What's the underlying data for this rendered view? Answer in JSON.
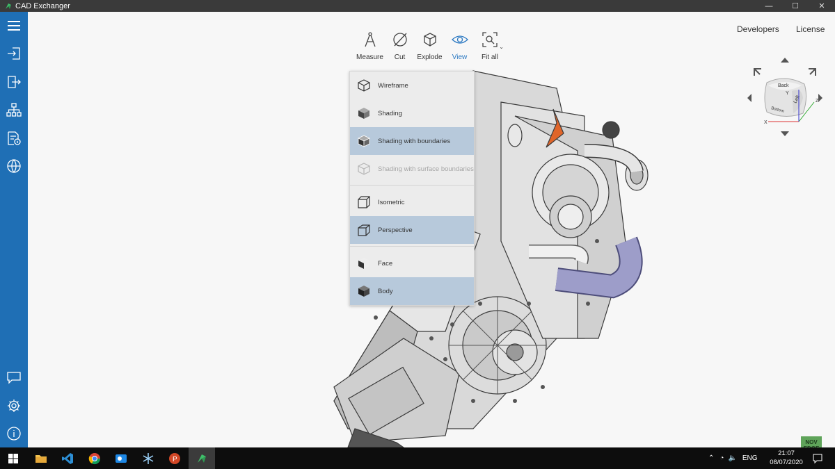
{
  "window": {
    "title": "CAD Exchanger",
    "minimize": "—",
    "maximize": "☐",
    "close": "✕"
  },
  "toolbar": {
    "tools": [
      {
        "label": "Measure",
        "icon": "compass-icon"
      },
      {
        "label": "Cut",
        "icon": "cut-icon"
      },
      {
        "label": "Explode",
        "icon": "explode-icon"
      },
      {
        "label": "View",
        "icon": "eye-icon",
        "active": true
      },
      {
        "label": "Fit all",
        "icon": "fit-all-icon"
      }
    ],
    "fit_caret": "⌄"
  },
  "header_links": {
    "developers": "Developers",
    "license": "License"
  },
  "view_menu": {
    "display_modes": [
      {
        "label": "Wireframe",
        "icon": "wireframe-cube-icon",
        "selected": false
      },
      {
        "label": "Shading",
        "icon": "shaded-cube-icon",
        "selected": false
      },
      {
        "label": "Shading with boundaries",
        "icon": "shaded-boundaries-cube-icon",
        "selected": true
      },
      {
        "label": "Shading with surface boundaries",
        "icon": "surface-boundaries-cube-icon",
        "selected": false,
        "disabled": true
      }
    ],
    "projections": [
      {
        "label": "Isometric",
        "icon": "isometric-cube-icon",
        "selected": false
      },
      {
        "label": "Perspective",
        "icon": "perspective-cube-icon",
        "selected": true
      }
    ],
    "selection_modes": [
      {
        "label": "Face",
        "icon": "face-select-icon",
        "selected": false
      },
      {
        "label": "Body",
        "icon": "body-select-icon",
        "selected": true
      }
    ]
  },
  "viewcube": {
    "faces": [
      "Back",
      "Left",
      "Bottom"
    ],
    "axes": [
      "X",
      "Y",
      "Z"
    ]
  },
  "taskbar": {
    "tray_lang": "ENG",
    "time": "21:07",
    "date": "08/07/2020"
  },
  "watermark": {
    "line1": "NOV",
    "line2": "EDGE"
  },
  "colors": {
    "sidebar": "#1f6fb5",
    "accent": "#2a78c2",
    "selected": "#b7c9db"
  }
}
